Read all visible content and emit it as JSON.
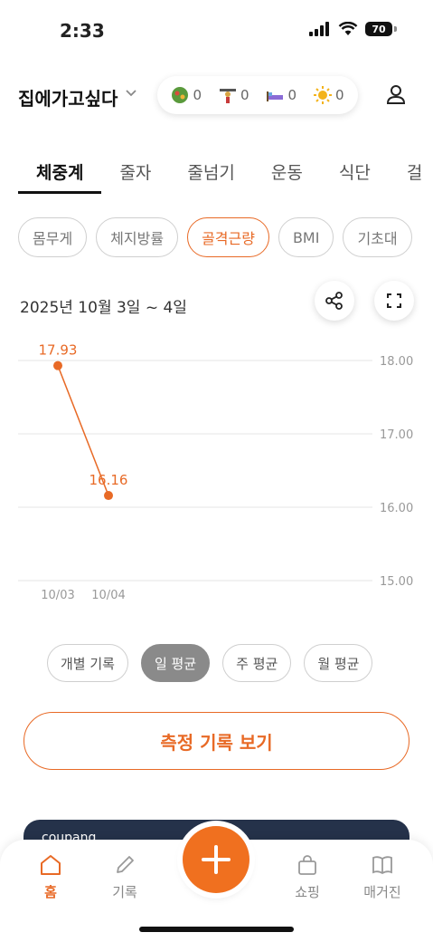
{
  "status_bar": {
    "time": "2:33",
    "battery": "70"
  },
  "header": {
    "title": "집에가고싶다",
    "stats": [
      {
        "icon": "salad-icon",
        "value": "0",
        "color": "#5a9a3c"
      },
      {
        "icon": "weightlifter-icon",
        "value": "0",
        "color": "#d9a441"
      },
      {
        "icon": "bed-icon",
        "value": "0",
        "color": "#8a6bd6"
      },
      {
        "icon": "sun-icon",
        "value": "0",
        "color": "#f3b31b"
      }
    ]
  },
  "tabs": [
    "체중계",
    "줄자",
    "줄넘기",
    "운동",
    "식단",
    "걸"
  ],
  "chips": [
    "몸무게",
    "체지방률",
    "골격근량",
    "BMI",
    "기초대"
  ],
  "date_range": "2025년 10월 3일 ~ 4일",
  "chart_data": {
    "type": "line",
    "x": [
      "10/03",
      "10/04"
    ],
    "series": [
      {
        "values": [
          17.93,
          16.16
        ],
        "color": "#e86a26"
      }
    ],
    "y_ticks": [
      "18.00",
      "17.00",
      "16.00",
      "15.00"
    ],
    "ylim": [
      15.0,
      18.0
    ],
    "data_labels": [
      "17.93",
      "16.16"
    ],
    "grid": true
  },
  "periods": [
    "개별 기록",
    "일 평균",
    "주 평균",
    "월 평균"
  ],
  "records_button": "측정 기록 보기",
  "banner": {
    "text": "coupang"
  },
  "nav": [
    "홈",
    "기록",
    "쇼핑",
    "매거진"
  ],
  "colors": {
    "accent": "#e86a26",
    "selected_period": "#8a8a8a"
  }
}
